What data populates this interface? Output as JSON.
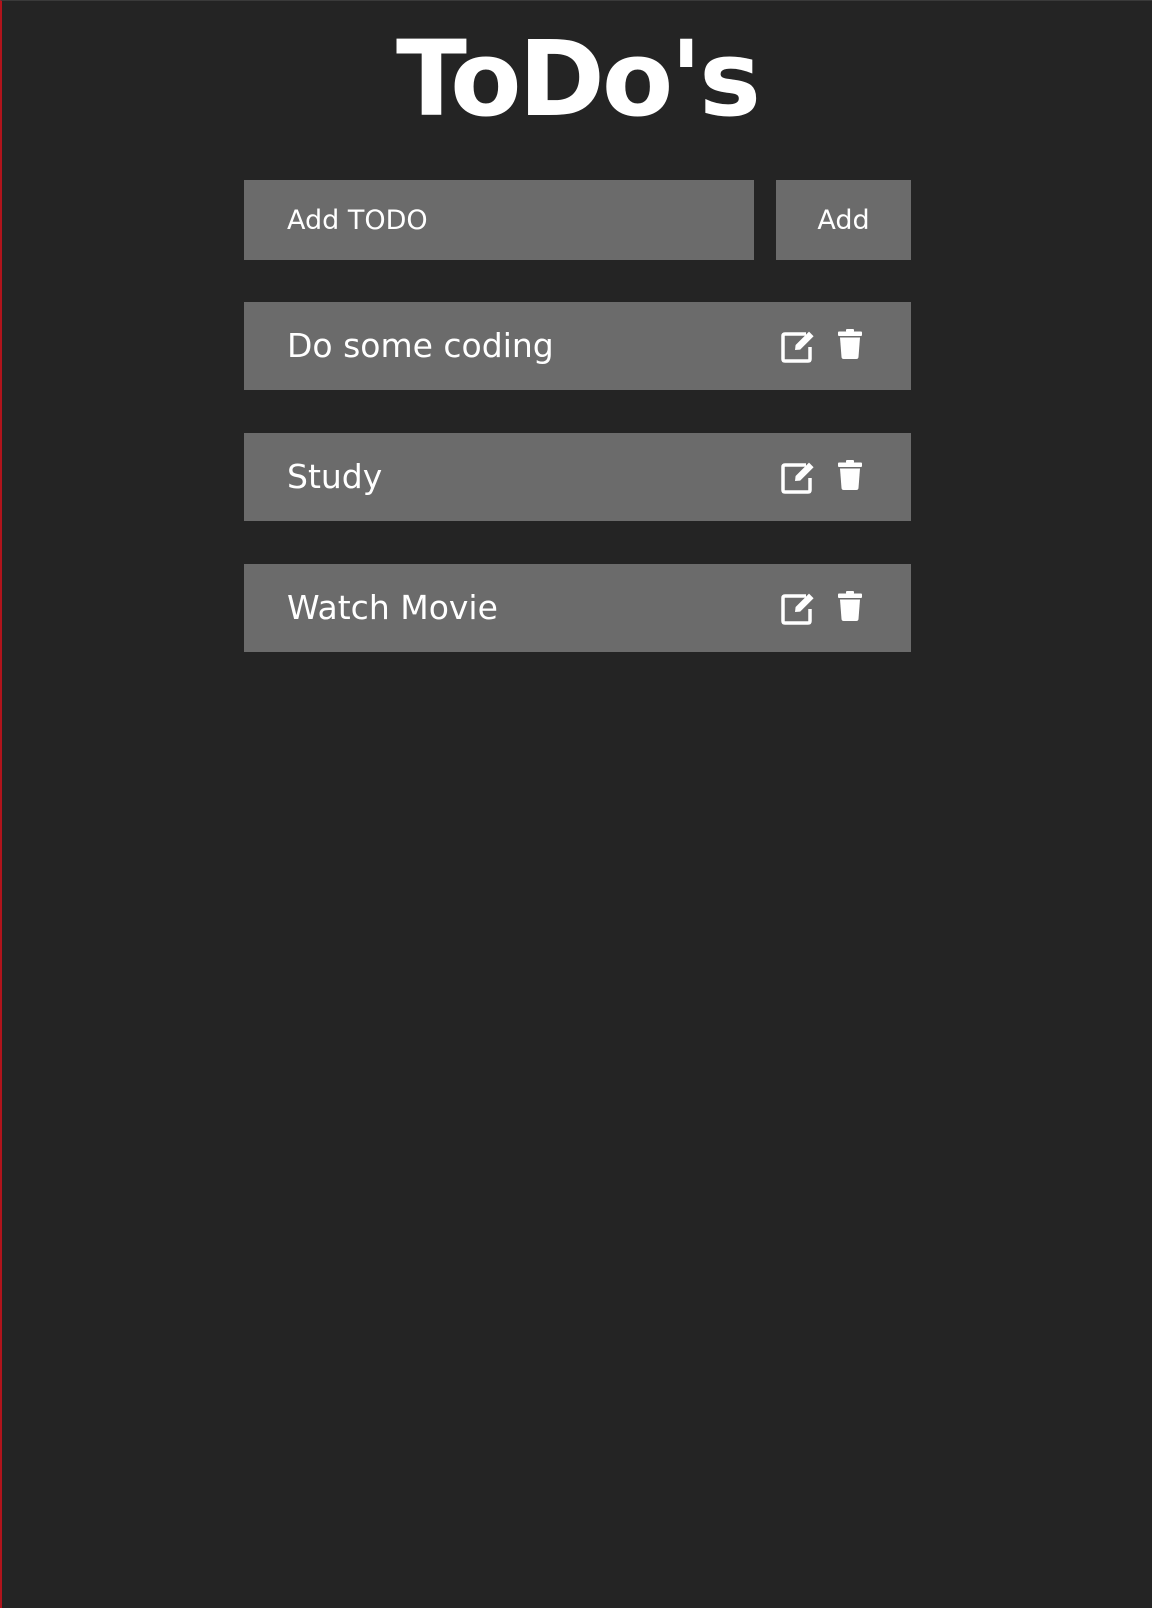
{
  "header": {
    "title": "ToDo's"
  },
  "add_form": {
    "placeholder": "Add TODO",
    "button_label": "Add"
  },
  "todos": [
    {
      "text": "Do some coding"
    },
    {
      "text": "Study"
    },
    {
      "text": "Watch Movie"
    }
  ],
  "icons": {
    "edit": "edit-icon",
    "delete": "trash-icon"
  },
  "colors": {
    "background": "#242424",
    "panel": "#6b6b6b",
    "text": "#ffffff",
    "window_edge": "#b0141c"
  }
}
